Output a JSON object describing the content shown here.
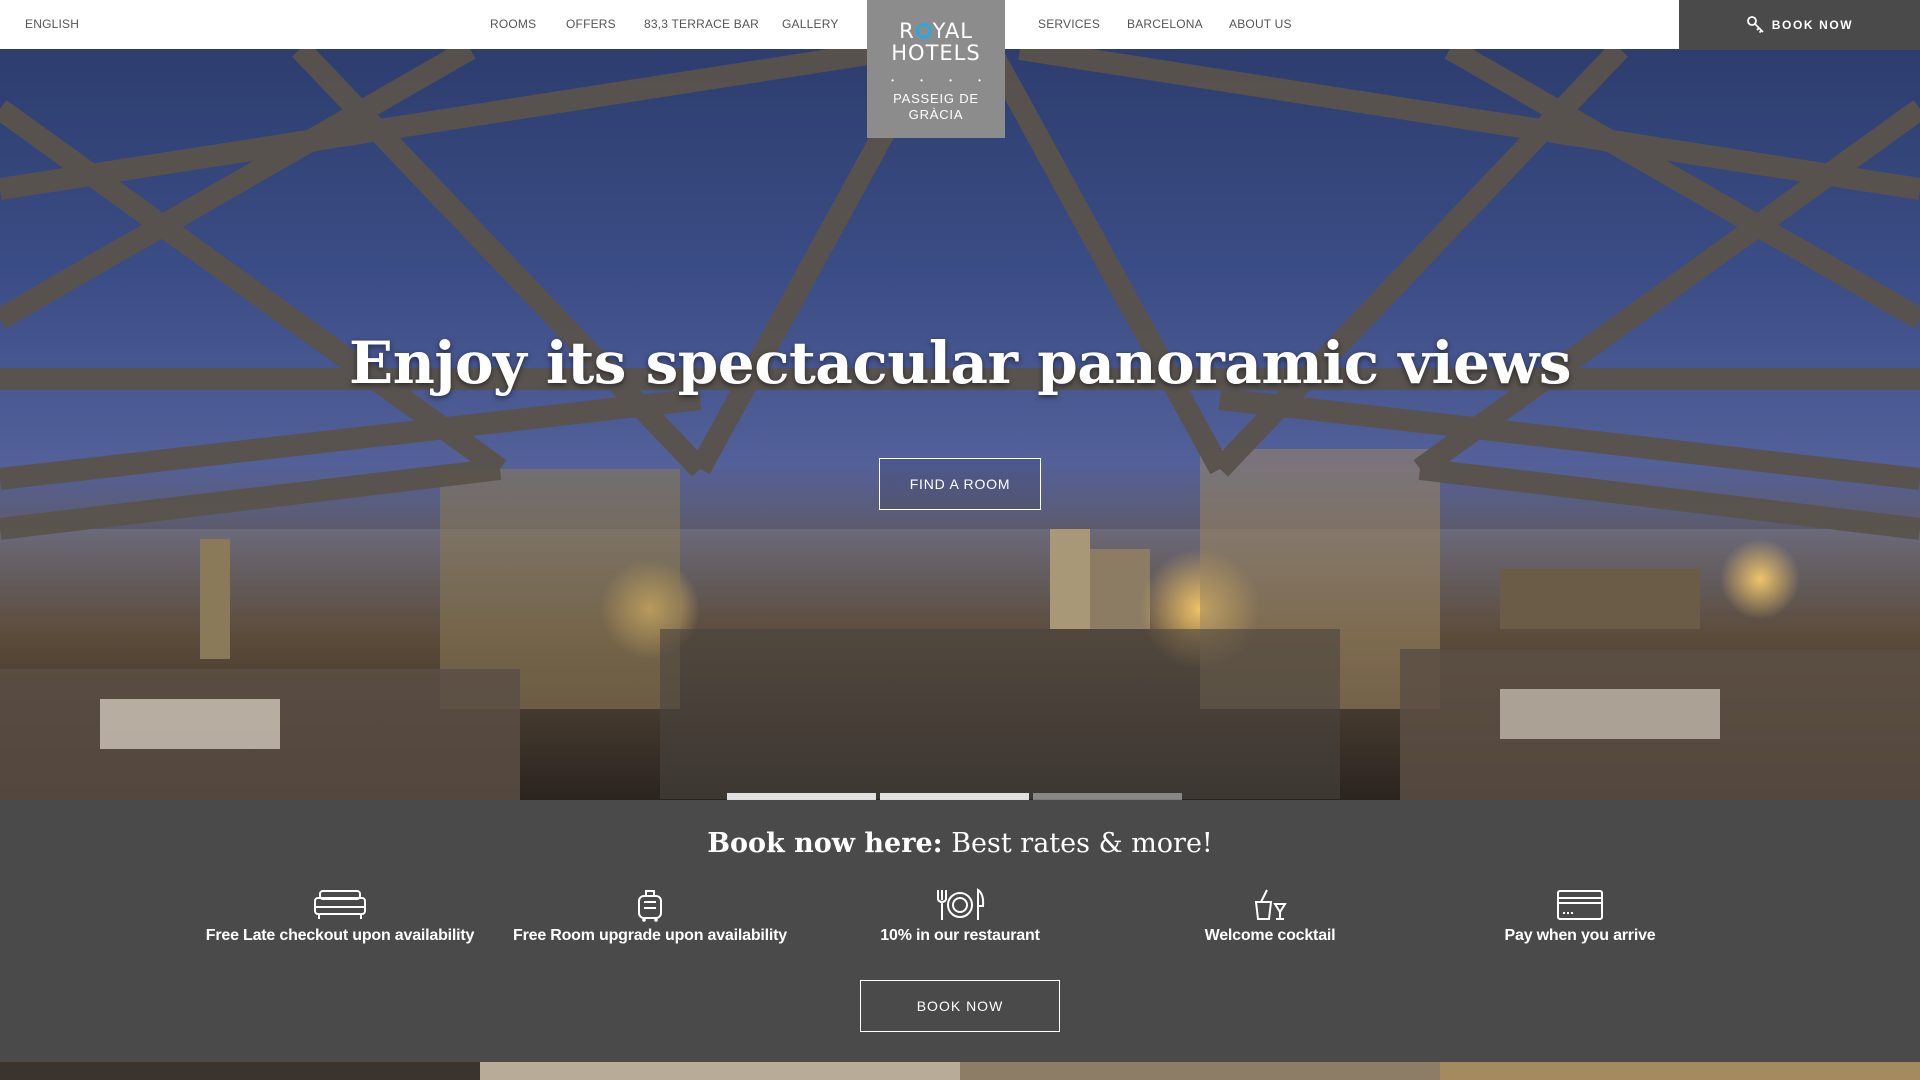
{
  "topbar": {
    "language": "ENGLISH",
    "nav_left": [
      "ROOMS",
      "OFFERS",
      "83,3 TERRACE BAR",
      "GALLERY"
    ],
    "nav_right": [
      "SERVICES",
      "BARCELONA",
      "ABOUT US"
    ],
    "book_now": "BOOK NOW",
    "book_icon": "key-icon"
  },
  "logo": {
    "line1_a": "R",
    "line1_b": "YAL",
    "line2": "HOTELS",
    "stars": "• • • •",
    "sub1": "PASSEIG DE",
    "sub2": "GRÀCIA",
    "accent_color": "#29a8e0"
  },
  "hero": {
    "title": "Enjoy its spectacular panoramic views",
    "cta": "FIND A ROOM",
    "slides_total": 3,
    "slide_active": 1
  },
  "booking": {
    "title_bold": "Book now here:",
    "title_rest": " Best rates & more!",
    "benefits": [
      {
        "icon": "bed-icon",
        "text": "Free Late checkout upon availability"
      },
      {
        "icon": "luggage-icon",
        "text": "Free Room upgrade upon availability"
      },
      {
        "icon": "restaurant-icon",
        "text": "10% in our restaurant"
      },
      {
        "icon": "cocktail-icon",
        "text": "Welcome cocktail"
      },
      {
        "icon": "credit-card-icon",
        "text": "Pay when you arrive"
      }
    ],
    "cta": "BOOK NOW"
  },
  "colors": {
    "dark_panel": "#4a4a4a",
    "logo_bg": "#8c8c8c",
    "white": "#ffffff"
  }
}
